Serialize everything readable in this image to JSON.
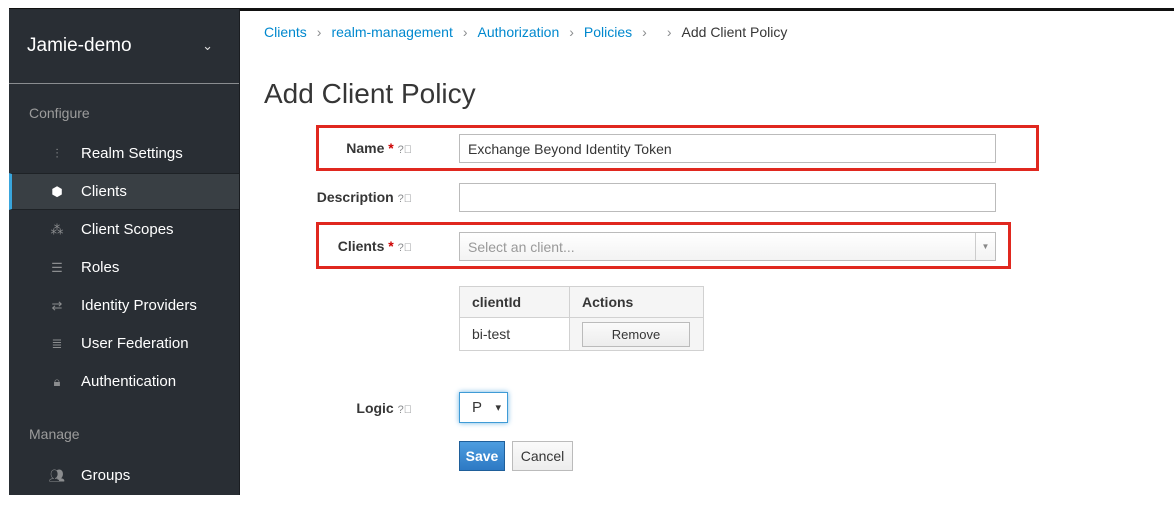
{
  "sidebar": {
    "realm": "Jamie-demo",
    "sections": {
      "configure": "Configure",
      "manage": "Manage"
    },
    "items": [
      {
        "label": "Realm Settings",
        "icon": "sliders-icon"
      },
      {
        "label": "Clients",
        "icon": "cube-icon",
        "active": true
      },
      {
        "label": "Client Scopes",
        "icon": "cubes-icon"
      },
      {
        "label": "Roles",
        "icon": "list-icon"
      },
      {
        "label": "Identity Providers",
        "icon": "exchange-icon"
      },
      {
        "label": "User Federation",
        "icon": "database-icon"
      },
      {
        "label": "Authentication",
        "icon": "lock-icon"
      },
      {
        "label": "Groups",
        "icon": "users-icon"
      }
    ]
  },
  "breadcrumb": [
    "Clients",
    "realm-management",
    "Authorization",
    "Policies",
    "Add Client Policy"
  ],
  "page_title": "Add Client Policy",
  "form": {
    "name_label": "Name",
    "name_value": "Exchange Beyond Identity Token",
    "description_label": "Description",
    "description_value": "",
    "clients_label": "Clients",
    "clients_placeholder": "Select an client...",
    "required_mark": "*",
    "table": {
      "headers": [
        "clientId",
        "Actions"
      ],
      "rows": [
        {
          "clientId": "bi-test",
          "action": "Remove"
        }
      ]
    },
    "logic_label": "Logic",
    "logic_value": "P",
    "save": "Save",
    "cancel": "Cancel"
  },
  "colors": {
    "accent": "#0088ce",
    "highlight_box": "#e0281f",
    "sidebar": "#292e34"
  }
}
